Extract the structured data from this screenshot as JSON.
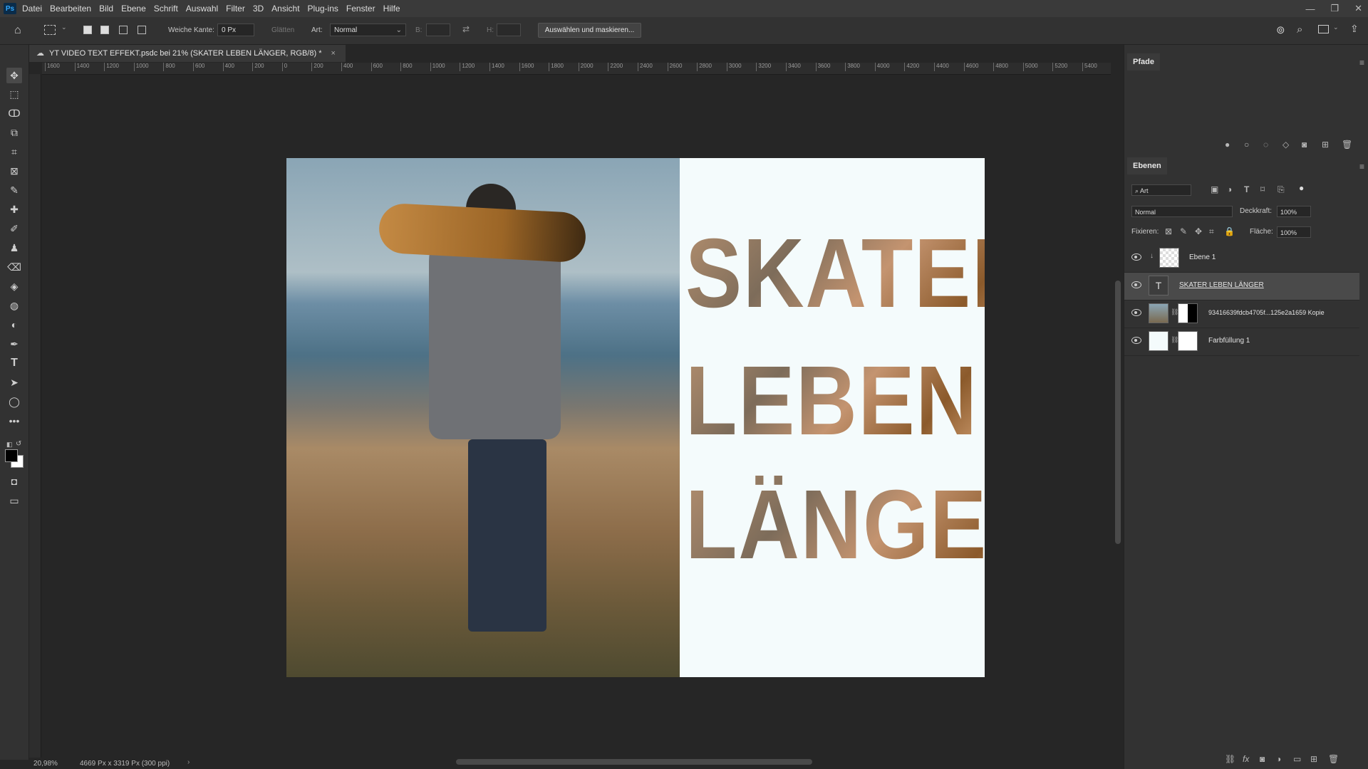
{
  "app": {
    "logo_text": "Ps"
  },
  "menu": [
    "Datei",
    "Bearbeiten",
    "Bild",
    "Ebene",
    "Schrift",
    "Auswahl",
    "Filter",
    "3D",
    "Ansicht",
    "Plug-ins",
    "Fenster",
    "Hilfe"
  ],
  "window_controls": {
    "minimize": "—",
    "restore": "❐",
    "close": "✕"
  },
  "options": {
    "feather_label": "Weiche Kante:",
    "feather_value": "0 Px",
    "smooth_label": "Glätten",
    "style_label": "Art:",
    "style_value": "Normal",
    "width_label": "B:",
    "height_label": "H:",
    "select_mask_button": "Auswählen und maskieren..."
  },
  "document": {
    "tab_title": "YT VIDEO TEXT EFFEKT.psdc bei 21% (SKATER LEBEN LÄNGER, RGB/8) *",
    "tab_close": "×",
    "words": [
      "SKATER",
      "LEBEN",
      "LÄNGER"
    ]
  },
  "ruler_h": [
    "1600",
    "1400",
    "1200",
    "1000",
    "800",
    "600",
    "400",
    "200",
    "0",
    "200",
    "400",
    "600",
    "800",
    "1000",
    "1200",
    "1400",
    "1600",
    "1800",
    "2000",
    "2200",
    "2400",
    "2600",
    "2800",
    "3000",
    "3200",
    "3400",
    "3600",
    "3800",
    "4000",
    "4200",
    "4400",
    "4600",
    "4800",
    "5000",
    "5200",
    "5400"
  ],
  "status": {
    "zoom": "20,98%",
    "doc_info": "4669 Px x 3319 Px (300 ppi)"
  },
  "panels": {
    "paths_tab": "Pfade",
    "layers_tab": "Ebenen",
    "filter_kind": "Art",
    "blend_mode": "Normal",
    "opacity_label": "Deckkraft:",
    "opacity_value": "100%",
    "lock_label": "Fixieren:",
    "fill_label": "Fläche:",
    "fill_value": "100%",
    "layers": [
      {
        "name": "Ebene 1"
      },
      {
        "name": "SKATER LEBEN LÄNGER"
      },
      {
        "name": "93416639fdcb4705f...125e2a1659 Kopie"
      },
      {
        "name": "Farbfüllung 1"
      }
    ]
  },
  "colors": {
    "menubar": "#3a3a3a",
    "panel": "#323232",
    "workspace": "#262626",
    "canvas_white": "#f4fbfc",
    "selected_layer": "#4a4a4a"
  }
}
